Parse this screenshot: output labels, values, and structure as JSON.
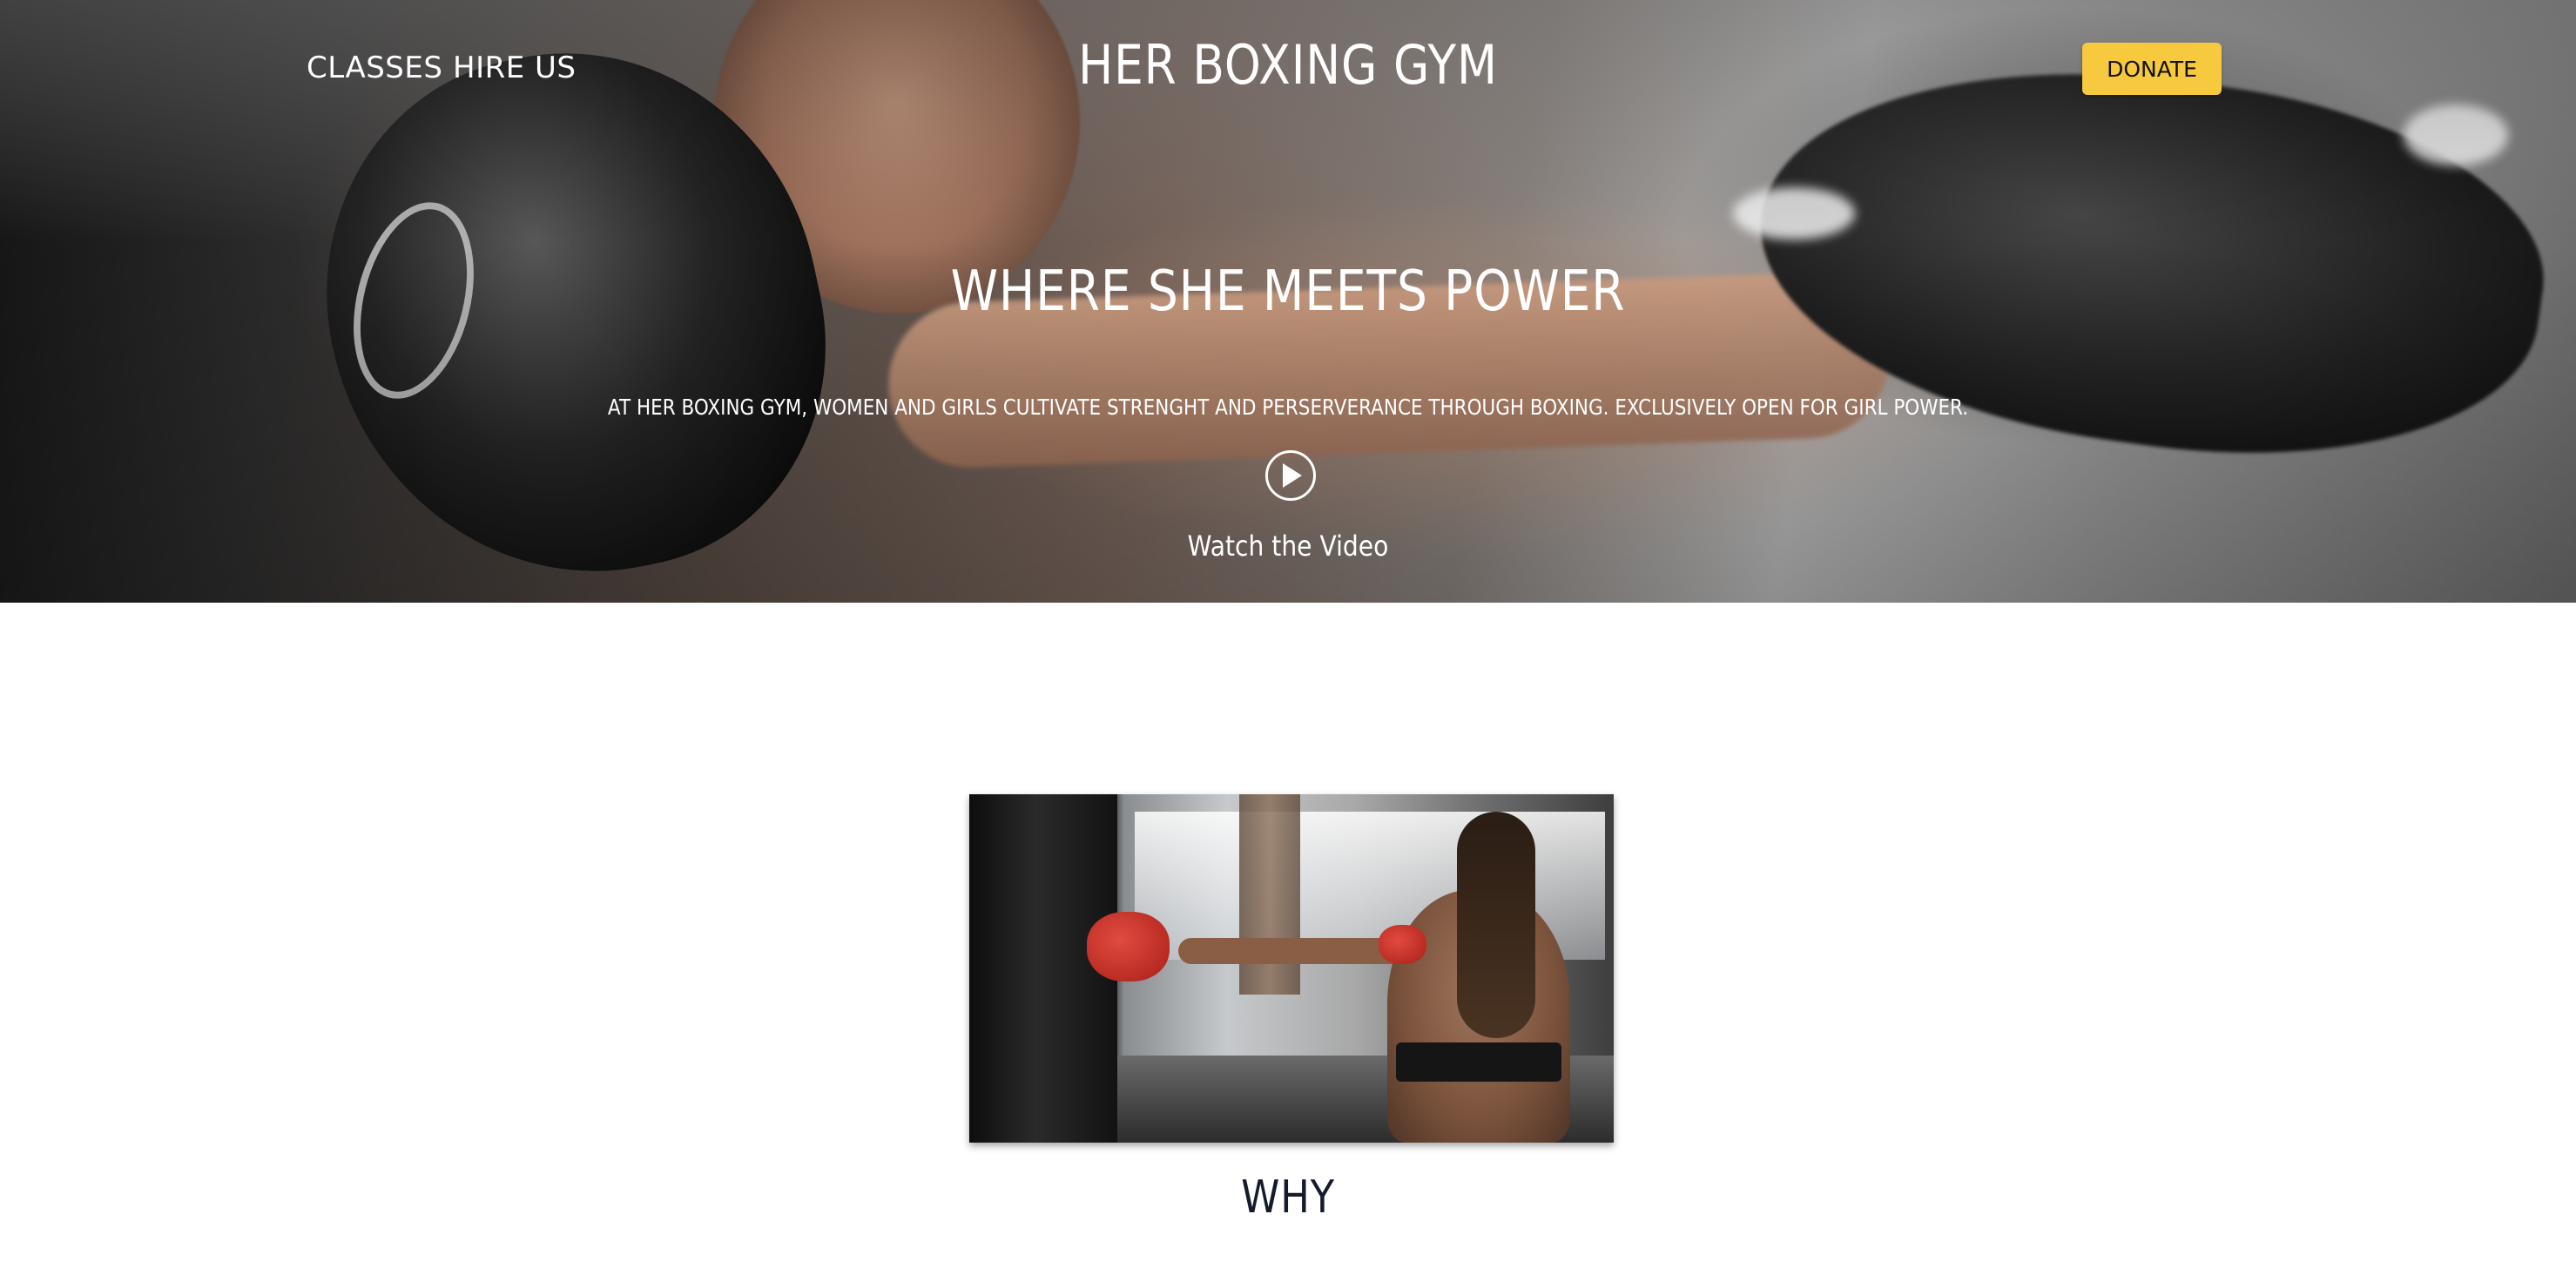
{
  "nav": {
    "classes_label": "CLASSES",
    "hire_label": "HIRE US"
  },
  "brand": {
    "name": "HER BOXING GYM"
  },
  "header": {
    "donate_label": "DONATE"
  },
  "hero": {
    "title": "WHERE SHE MEETS POWER",
    "subtitle": "AT HER BOXING GYM, WOMEN AND GIRLS CULTIVATE STRENGHT AND PERSERVERANCE THROUGH BOXING. EXCLUSIVELY OPEN FOR GIRL POWER.",
    "play_icon": "play-circle-icon",
    "video_label": "Watch the Video"
  },
  "section": {
    "title": "WHY"
  },
  "colors": {
    "accent": "#f6c93f",
    "heading_dark": "#141b2a",
    "hero_text": "#ffffff"
  }
}
